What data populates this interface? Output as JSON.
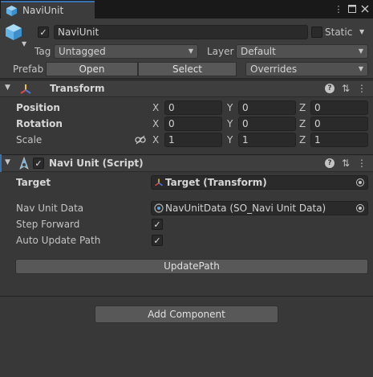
{
  "window": {
    "tab_label": "NaviUnit",
    "tab_icon": "gameobject-cube-icon",
    "controls": [
      "kebab-menu-icon",
      "maximize-icon",
      "close-icon"
    ]
  },
  "header": {
    "active_checked": true,
    "name_value": "NaviUnit",
    "static_label": "Static",
    "static_checked": false,
    "tag_label": "Tag",
    "tag_value": "Untagged",
    "layer_label": "Layer",
    "layer_value": "Default",
    "prefab_label": "Prefab",
    "open_label": "Open",
    "select_label": "Select",
    "overrides_label": "Overrides"
  },
  "transform": {
    "title": "Transform",
    "position_label": "Position",
    "rotation_label": "Rotation",
    "scale_label": "Scale",
    "axis_x": "X",
    "axis_y": "Y",
    "axis_z": "Z",
    "position": {
      "x": "0",
      "y": "0",
      "z": "0"
    },
    "rotation": {
      "x": "0",
      "y": "0",
      "z": "0"
    },
    "scale": {
      "x": "1",
      "y": "1",
      "z": "1"
    }
  },
  "script": {
    "enabled": true,
    "title": "Navi Unit (Script)",
    "target_label": "Target",
    "target_value": "Target (Transform)",
    "data_label": "Nav Unit Data",
    "data_value": "NavUnitData (SO_Navi Unit Data)",
    "step_forward_label": "Step Forward",
    "step_forward_checked": true,
    "auto_update_label": "Auto Update Path",
    "auto_update_checked": true,
    "update_path_button": "UpdatePath"
  },
  "footer": {
    "add_component_button": "Add Component"
  },
  "colors": {
    "background": "#383838",
    "tab_accent": "#3a72b0",
    "field": "#2a2a2a",
    "button": "#585858"
  }
}
